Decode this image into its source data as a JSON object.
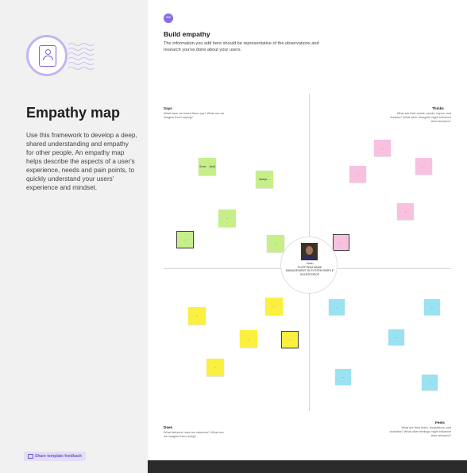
{
  "sidebar": {
    "title": "Empathy map",
    "description": "Use this framework to develop a deep, shared understanding and empathy for other people. An empathy map helps describe the aspects of a user's experience, needs and pain points, to quickly understand your users' experience and mindset.",
    "feedback_label": "Share template feedback"
  },
  "main": {
    "title": "Build empathy",
    "subtitle": "The information you add here should be representative of the observations and research you've done about your users.",
    "quadrants": {
      "says": {
        "title": "Says",
        "sub": "What have we heard them say? What can we imagine them saying?"
      },
      "thinks": {
        "title": "Thinks",
        "sub": "What are their wants, needs, hopes, and dreams? What other thoughts might influence their behavior?"
      },
      "does": {
        "title": "Does",
        "sub": "What behavior have we observed? What can we imagine them doing?"
      },
      "feels": {
        "title": "Feels",
        "sub": "What are their fears, frustrations, and anxieties? What other feelings might influence their behavior?"
      }
    },
    "persona": {
      "name": "Yanin\nPLATFORM NAME\nMANAGEMENT IN SYSTEM SIMPLE\nSALESFORCE"
    },
    "notes": {
      "g1": "Some ... (text)",
      "g2": "Always ...",
      "g3": "...",
      "g4": "...",
      "g5": "...",
      "p1": "...",
      "p2": "...",
      "p3": "...",
      "p4": "...",
      "p5": "...",
      "y1": "...",
      "y2": "...",
      "y3": "...",
      "y4": "...",
      "y5": "...",
      "b1": "...",
      "b2": "...",
      "b3": "...",
      "b4": "...",
      "b5": "..."
    }
  },
  "colors": {
    "accent": "#8a6be3",
    "green": "#c6ef8a",
    "pink": "#f8c1e0",
    "yellow": "#fbef3f",
    "blue": "#9ae2f1"
  }
}
